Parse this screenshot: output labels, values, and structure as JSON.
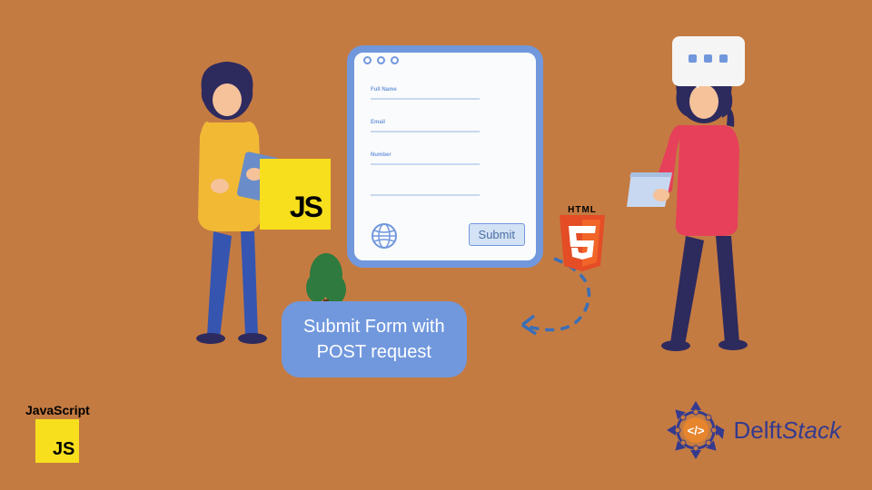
{
  "form": {
    "field1": "Full Name",
    "field2": "Email",
    "field3": "Number",
    "submit": "Submit"
  },
  "caption": {
    "line1": "Submit Form with",
    "line2": "POST request"
  },
  "logos": {
    "js": "JS",
    "html5": "HTML",
    "jsCorner": "JavaScript",
    "jsCornerBadge": "JS",
    "delft1": "Delft",
    "delft2": "Stack"
  }
}
